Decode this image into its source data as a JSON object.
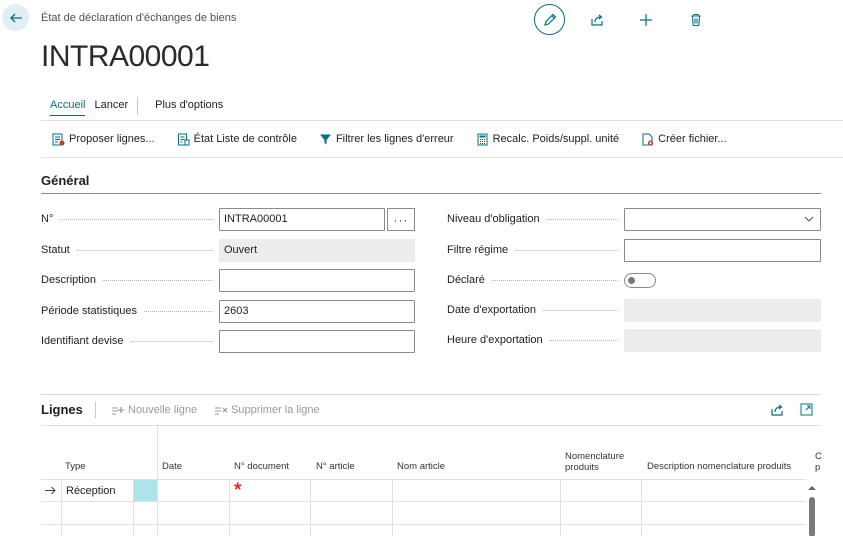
{
  "header": {
    "breadcrumb": "État de déclaration d'échanges de biens",
    "title": "INTRA00001"
  },
  "tabs": [
    {
      "label": "Accueil"
    },
    {
      "label": "Lancer"
    },
    {
      "label": "Plus d'options"
    }
  ],
  "actions": [
    {
      "label": "Proposer lignes...",
      "icon": "suggest-lines-icon"
    },
    {
      "label": "État Liste de contrôle",
      "icon": "report-icon"
    },
    {
      "label": "Filtrer les lignes d'erreur",
      "icon": "filter-icon"
    },
    {
      "label": "Recalc. Poids/suppl. unité",
      "icon": "calculator-icon"
    },
    {
      "label": "Créer fichier...",
      "icon": "create-file-icon"
    }
  ],
  "general": {
    "title": "Général",
    "no_label": "N°",
    "no_value": "INTRA00001",
    "status_label": "Statut",
    "status_value": "Ouvert",
    "description_label": "Description",
    "description_value": "",
    "period_label": "Période statistiques",
    "period_value": "2603",
    "currency_label": "Identifiant devise",
    "currency_value": "",
    "obligation_label": "Niveau d'obligation",
    "obligation_value": "",
    "regime_label": "Filtre régime",
    "regime_value": "",
    "declared_label": "Déclaré",
    "declared_value": false,
    "export_date_label": "Date d'exportation",
    "export_date_value": "",
    "export_time_label": "Heure d'exportation",
    "export_time_value": ""
  },
  "lines": {
    "title": "Lignes",
    "new_line_label": "Nouvelle ligne",
    "delete_line_label": "Supprimer la ligne",
    "columns": {
      "type": "Type",
      "date": "Date",
      "doc_no": "N° document",
      "item_no": "N° article",
      "item_name": "Nom article",
      "tariff_1": "Nomenclature",
      "tariff_2": "produits",
      "tariff_desc": "Description nomenclature produits",
      "cut_1": "C",
      "cut_2": "p"
    },
    "rows": [
      {
        "type": "Réception",
        "required_marker": "*"
      }
    ]
  }
}
